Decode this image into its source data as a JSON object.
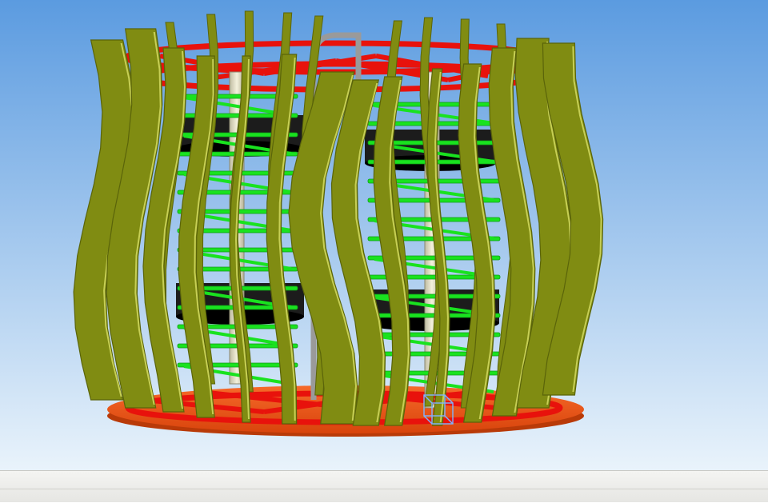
{
  "colors": {
    "sky_top": "#5b9be0",
    "sky_bottom": "#e9f3fb",
    "fin_fill": "#808c12",
    "fin_dark": "#5a640a",
    "fin_edge": "#c7cf55",
    "ring_red": "#e8120c",
    "rung_green": "#19e21f",
    "rung_green_dark": "#0f9a16",
    "disc_black": "#1c1c1c",
    "base_orange": "#f2571a",
    "rod_cream": "#e9e6cf",
    "frame_gray": "#9a9a9a"
  },
  "icons": {
    "coordinate_triad": "triad-icon"
  },
  "statusbar": {
    "left_text": "",
    "right_text": ""
  }
}
